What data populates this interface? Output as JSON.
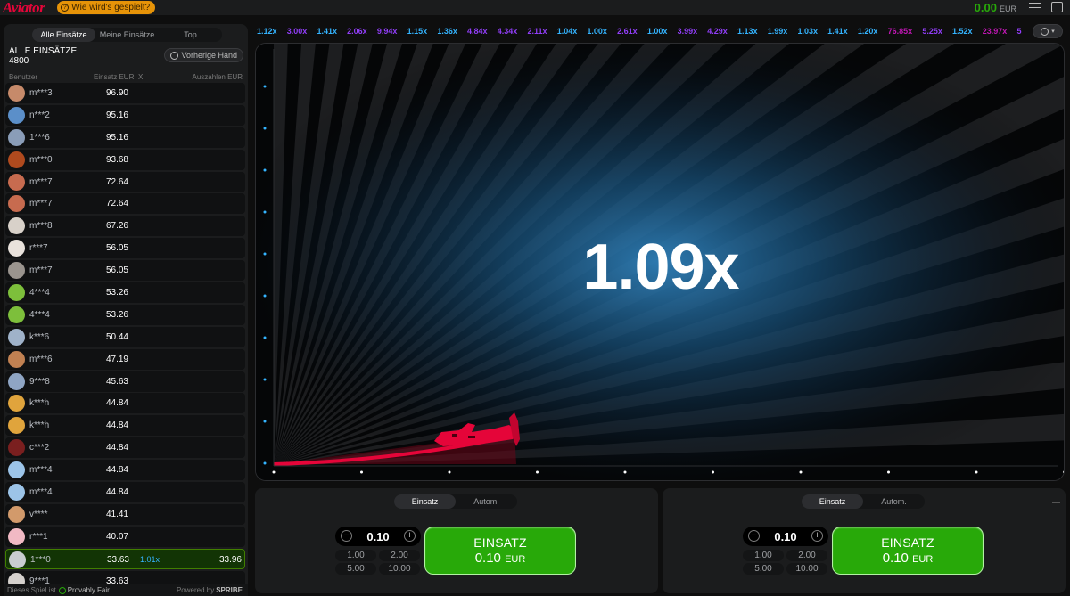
{
  "header": {
    "logo": "Aviator",
    "how_to_play": "Wie wird's gespielt?",
    "balance": "0.00",
    "currency": "EUR"
  },
  "bets_panel": {
    "tabs": [
      "Alle Einsätze",
      "Meine Einsätze",
      "Top"
    ],
    "title": "ALLE EINSÄTZE",
    "count": "4800",
    "prev_hand": "Vorherige Hand",
    "columns": {
      "user": "Benutzer",
      "bet": "Einsatz EUR",
      "x": "X",
      "payout": "Auszahlen EUR"
    },
    "rows": [
      {
        "user": "m***3",
        "bet": "96.90",
        "mult": "",
        "payout": "",
        "av": "#c68a6a",
        "win": false
      },
      {
        "user": "n***2",
        "bet": "95.16",
        "mult": "",
        "payout": "",
        "av": "#5b8fc9",
        "win": false
      },
      {
        "user": "1***6",
        "bet": "95.16",
        "mult": "",
        "payout": "",
        "av": "#8a9db8",
        "win": false
      },
      {
        "user": "m***0",
        "bet": "93.68",
        "mult": "",
        "payout": "",
        "av": "#b04a1e",
        "win": false
      },
      {
        "user": "m***7",
        "bet": "72.64",
        "mult": "",
        "payout": "",
        "av": "#c76b4f",
        "win": false
      },
      {
        "user": "m***7",
        "bet": "72.64",
        "mult": "",
        "payout": "",
        "av": "#c76b4f",
        "win": false
      },
      {
        "user": "m***8",
        "bet": "67.26",
        "mult": "",
        "payout": "",
        "av": "#d8d1c9",
        "win": false
      },
      {
        "user": "r***7",
        "bet": "56.05",
        "mult": "",
        "payout": "",
        "av": "#e9e2dc",
        "win": false
      },
      {
        "user": "m***7",
        "bet": "56.05",
        "mult": "",
        "payout": "",
        "av": "#9a948e",
        "win": false
      },
      {
        "user": "4***4",
        "bet": "53.26",
        "mult": "",
        "payout": "",
        "av": "#7dbf3b",
        "win": false
      },
      {
        "user": "4***4",
        "bet": "53.26",
        "mult": "",
        "payout": "",
        "av": "#7dbf3b",
        "win": false
      },
      {
        "user": "k***6",
        "bet": "50.44",
        "mult": "",
        "payout": "",
        "av": "#9fb2c9",
        "win": false
      },
      {
        "user": "m***6",
        "bet": "47.19",
        "mult": "",
        "payout": "",
        "av": "#c18152",
        "win": false
      },
      {
        "user": "9***8",
        "bet": "45.63",
        "mult": "",
        "payout": "",
        "av": "#8fa5c4",
        "win": false
      },
      {
        "user": "k***h",
        "bet": "44.84",
        "mult": "",
        "payout": "",
        "av": "#e0a43c",
        "win": false
      },
      {
        "user": "k***h",
        "bet": "44.84",
        "mult": "",
        "payout": "",
        "av": "#e0a43c",
        "win": false
      },
      {
        "user": "c***2",
        "bet": "44.84",
        "mult": "",
        "payout": "",
        "av": "#7a1f1f",
        "win": false
      },
      {
        "user": "m***4",
        "bet": "44.84",
        "mult": "",
        "payout": "",
        "av": "#9cc4e8",
        "win": false
      },
      {
        "user": "m***4",
        "bet": "44.84",
        "mult": "",
        "payout": "",
        "av": "#9cc4e8",
        "win": false
      },
      {
        "user": "v****",
        "bet": "41.41",
        "mult": "",
        "payout": "",
        "av": "#d29a6b",
        "win": false
      },
      {
        "user": "r***1",
        "bet": "40.07",
        "mult": "",
        "payout": "",
        "av": "#f1b9c4",
        "win": false
      },
      {
        "user": "1***0",
        "bet": "33.63",
        "mult": "1.01x",
        "payout": "33.96",
        "av": "#c9ccd1",
        "win": true
      },
      {
        "user": "9***1",
        "bet": "33.63",
        "mult": "",
        "payout": "",
        "av": "#d5d1cd",
        "win": false
      }
    ],
    "footer": {
      "prefix": "Dieses Spiel ist",
      "provably": "Provably Fair",
      "powered": "Powered by",
      "brand": "SPRIBE"
    }
  },
  "history": [
    {
      "v": "1.12x",
      "c": "#34b4ff"
    },
    {
      "v": "3.00x",
      "c": "#913ef8"
    },
    {
      "v": "1.41x",
      "c": "#34b4ff"
    },
    {
      "v": "2.06x",
      "c": "#913ef8"
    },
    {
      "v": "9.94x",
      "c": "#913ef8"
    },
    {
      "v": "1.15x",
      "c": "#34b4ff"
    },
    {
      "v": "1.36x",
      "c": "#34b4ff"
    },
    {
      "v": "4.84x",
      "c": "#913ef8"
    },
    {
      "v": "4.34x",
      "c": "#913ef8"
    },
    {
      "v": "2.11x",
      "c": "#913ef8"
    },
    {
      "v": "1.04x",
      "c": "#34b4ff"
    },
    {
      "v": "1.00x",
      "c": "#34b4ff"
    },
    {
      "v": "2.61x",
      "c": "#913ef8"
    },
    {
      "v": "1.00x",
      "c": "#34b4ff"
    },
    {
      "v": "3.99x",
      "c": "#913ef8"
    },
    {
      "v": "4.29x",
      "c": "#913ef8"
    },
    {
      "v": "1.13x",
      "c": "#34b4ff"
    },
    {
      "v": "1.99x",
      "c": "#34b4ff"
    },
    {
      "v": "1.03x",
      "c": "#34b4ff"
    },
    {
      "v": "1.41x",
      "c": "#34b4ff"
    },
    {
      "v": "1.20x",
      "c": "#34b4ff"
    },
    {
      "v": "76.85x",
      "c": "#c017b4"
    },
    {
      "v": "5.25x",
      "c": "#913ef8"
    },
    {
      "v": "1.52x",
      "c": "#34b4ff"
    },
    {
      "v": "23.97x",
      "c": "#c017b4"
    },
    {
      "v": "5",
      "c": "#913ef8"
    }
  ],
  "game": {
    "multiplier": "1.09x"
  },
  "panels": [
    {
      "tabs": [
        "Einsatz",
        "Autom."
      ],
      "value": "0.10",
      "quick": [
        "1.00",
        "2.00",
        "5.00",
        "10.00"
      ],
      "btn_label": "EINSATZ",
      "btn_amount": "0.10",
      "btn_currency": "EUR"
    },
    {
      "tabs": [
        "Einsatz",
        "Autom."
      ],
      "value": "0.10",
      "quick": [
        "1.00",
        "2.00",
        "5.00",
        "10.00"
      ],
      "btn_label": "EINSATZ",
      "btn_amount": "0.10",
      "btn_currency": "EUR"
    }
  ],
  "colors": {
    "accent_red": "#e50539",
    "green": "#28a909",
    "blue": "#34b4ff",
    "purple": "#913ef8",
    "magenta": "#c017b4"
  }
}
